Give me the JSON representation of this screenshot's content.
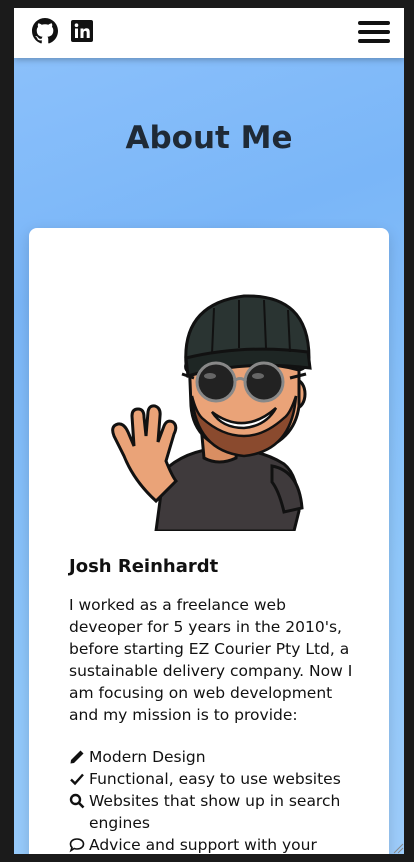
{
  "nav": {
    "icons": [
      "github-icon",
      "linkedin-icon"
    ],
    "menu_icon": "hamburger-menu-icon"
  },
  "header": {
    "title": "About Me"
  },
  "profile": {
    "name": "Josh Reinhardt",
    "bio": "I worked as a freelance web deveoper for 5 years in the 2010's, before starting EZ Courier Pty Ltd, a sustainable delivery company. Now I am focusing on web development and my mission is to provide:",
    "features": [
      {
        "icon": "pencil-icon",
        "text": "Modern Design"
      },
      {
        "icon": "check-icon",
        "text": "Functional, easy to use websites"
      },
      {
        "icon": "search-icon",
        "text": "Websites that show up in search engines"
      },
      {
        "icon": "comment-icon",
        "text": "Advice and support with your"
      }
    ]
  },
  "colors": {
    "background_gradient_start": "#8ec2fb",
    "background_gradient_end": "#9ecdfb",
    "title": "#1f2a36",
    "card": "#ffffff",
    "text": "#111111"
  }
}
